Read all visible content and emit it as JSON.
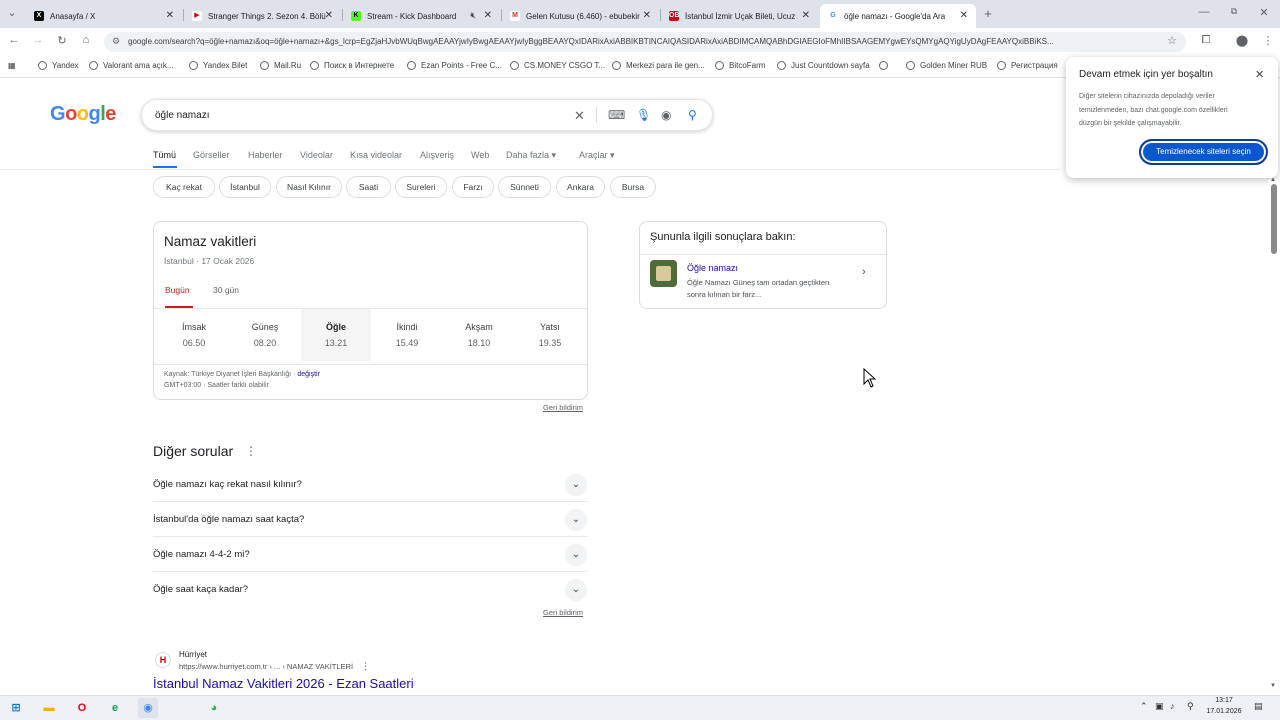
{
  "browser": {
    "tabs": [
      {
        "label": "Anasayfa / X",
        "icon": "x-logo-icon"
      },
      {
        "label": "Stranger Things 2. Sezon 4. Bölü",
        "icon": "play-icon"
      },
      {
        "label": "Stream - Kick Dashboard",
        "icon": "kick-logo-icon"
      },
      {
        "label": "Gelen Kutusu (6.460) - ebubekir",
        "icon": "gmail-icon"
      },
      {
        "label": "İstanbul İzmir Uçak Bileti, Ucuz",
        "icon": "ob-logo-icon"
      },
      {
        "label": "öğle namazı - Google'da Ara",
        "icon": "google-icon"
      }
    ],
    "new_tab": "+",
    "url": "google.com/search?q=öğle+namazı&oq=öğle+namazı+&gs_lcrp=EgZjaHJvbWUqBwgAEAAYjwIyBwgAEAAYjwIyBggBEAAYQxIDARixAxiABBIKBTINCAIQASIDARixAxiABDIMCAMQABhDGIAEGIoFMhIIBSAAGEMYgwEYsQMYgAQYigUyDAgFEAAYQxiBBiKS...",
    "bookmarks": [
      "Yandex",
      "Valorant ama açık...",
      "Yandex Bilet",
      "Mail.Ru",
      "Поиск в Интернете",
      "Ezan Points - Free C...",
      "CS.MONEY CSGO T...",
      "Merkezi para ile gen...",
      "BitcoFarm",
      "Just Countdown sayfa",
      "",
      "Golden Miner RUB",
      "Регистрация"
    ]
  },
  "search": {
    "logo": "Google",
    "query": "öğle namazı",
    "nav": [
      "Tümü",
      "Görseller",
      "Haberler",
      "Videolar",
      "Kısa videolar",
      "Alışveriş",
      "Web",
      "Daha fazla ▾",
      "Araçlar ▾"
    ],
    "chips": [
      "Kaç rekat",
      "İstanbul",
      "Nasıl Kılınır",
      "Saati",
      "Sureleri",
      "Farzı",
      "Sünneti",
      "Ankara",
      "Bursa"
    ]
  },
  "prayer_card": {
    "title": "Namaz vakitleri",
    "subtitle": "İstanbul · 17 Ocak 2026",
    "tabs": [
      "Bugün",
      "30 gün"
    ],
    "times": [
      {
        "name": "İmsak",
        "time": "06.50"
      },
      {
        "name": "Güneş",
        "time": "08.20"
      },
      {
        "name": "Öğle",
        "time": "13.21"
      },
      {
        "name": "İkindi",
        "time": "15.49"
      },
      {
        "name": "Akşam",
        "time": "18.10"
      },
      {
        "name": "Yatsı",
        "time": "19.35"
      }
    ],
    "source": "Kaynak: Türkiye Diyanet İşleri Başkanlığı · ",
    "source_link": "değiştir",
    "timezone": "GMT+03:00 · Saatler farklı olabilir",
    "feedback": "Geri bildirim"
  },
  "paa": {
    "title": "Diğer sorular",
    "questions": [
      "Öğle namazı kaç rekat nasıl kılınır?",
      "İstanbul'da öğle namazı saat kaçta?",
      "Öğle namazı 4-4-2 mi?",
      "Öğle saat kaça kadar?"
    ],
    "feedback": "Geri bildirim"
  },
  "result": {
    "site": "Hürriyet",
    "url": "https://www.hurriyet.com.tr › ... › NAMAZ VAKİTLERİ",
    "title": "İstanbul Namaz Vakitleri 2026 - Ezan Saatleri"
  },
  "side_panel": {
    "title": "Şununla ilgili sonuçlara bakın:",
    "link": "Öğle namazı",
    "desc": "Öğle Namazı Güneş tam ortadan geçtikten sonra kılınan bir farz..."
  },
  "popup": {
    "title": "Devam etmek için yer boşaltın",
    "body": "Diğer sitelerin cihazınızda depoladığı veriler temizlenmeden, bazı chat.google.com özellikleri düzgün bir şekilde çalışmayabilir.",
    "button": "Temizlenecek siteleri seçin"
  },
  "taskbar": {
    "time": "13:17",
    "date": "17.01.2026"
  },
  "colors": {
    "accent": "#1a73e8",
    "link": "#1a0dab",
    "active_tab_red": "#c5221f",
    "popup_button": "#0b57d0"
  }
}
